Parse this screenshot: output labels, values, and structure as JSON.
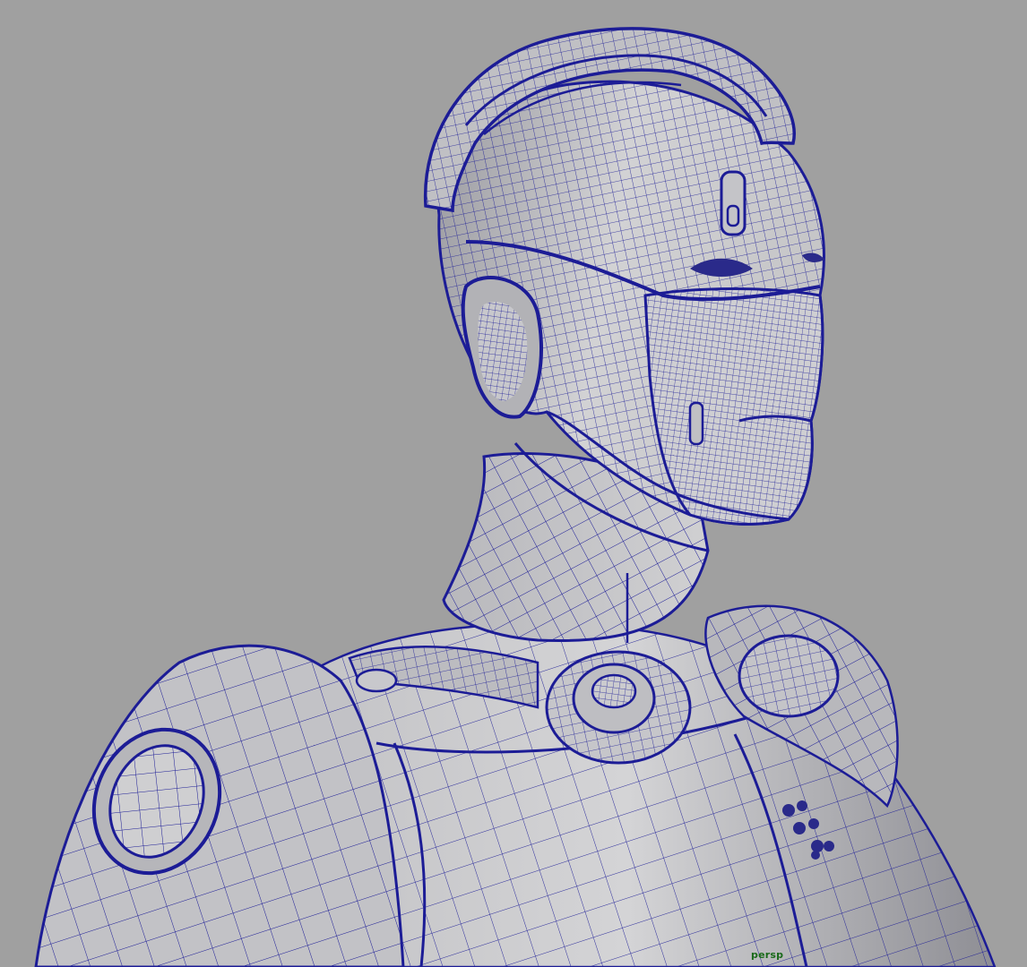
{
  "viewport": {
    "camera_label": "persp",
    "background_color": "#a0a0a0",
    "wireframe_color": "#1c1c96",
    "surface_color": "#c9c9cb",
    "shadow_color": "#6e6e74",
    "label_color": "#1a6a1a"
  }
}
